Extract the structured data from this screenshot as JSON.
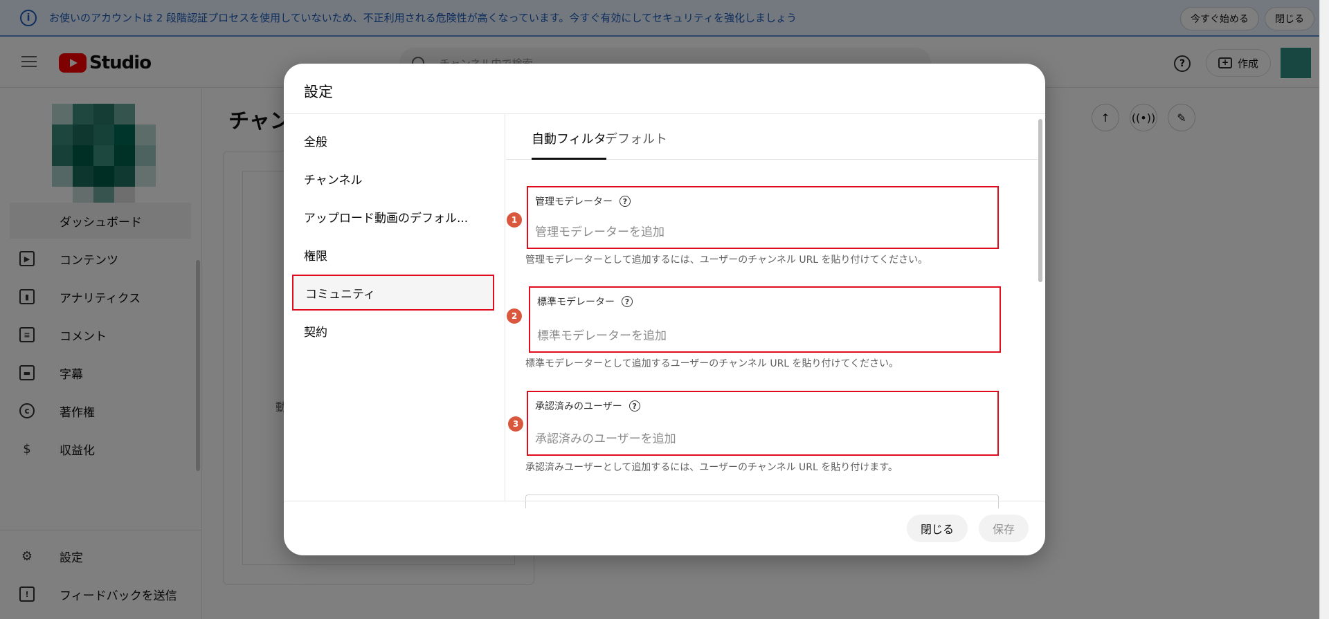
{
  "banner": {
    "message": "お使いのアカウントは 2 段階認証プロセスを使用していないため、不正利用される危険性が高くなっています。今すぐ有効にしてセキュリティを強化しましょう",
    "start_label": "今すぐ始める",
    "close_label": "閉じる"
  },
  "topbar": {
    "logo_text": "Studio",
    "search_placeholder": "チャンネル内で検索",
    "create_label": "作成"
  },
  "sidebar": {
    "items": [
      {
        "label": "ダッシュボード",
        "icon": "dashboard-icon"
      },
      {
        "label": "コンテンツ",
        "icon": "content-icon"
      },
      {
        "label": "アナリティクス",
        "icon": "analytics-icon"
      },
      {
        "label": "コメント",
        "icon": "comment-icon"
      },
      {
        "label": "字幕",
        "icon": "subtitles-icon"
      },
      {
        "label": "著作権",
        "icon": "copyright-icon"
      },
      {
        "label": "収益化",
        "icon": "monetization-icon"
      }
    ],
    "bottom_items": [
      {
        "label": "設定",
        "icon": "gear-icon"
      },
      {
        "label": "フィードバックを送信",
        "icon": "feedback-icon"
      }
    ]
  },
  "main": {
    "title_partial": "チャン",
    "card_partial_char": "動"
  },
  "dialog": {
    "title": "設定",
    "nav": [
      "全般",
      "チャンネル",
      "アップロード動画のデフォル...",
      "権限",
      "コミュニティ",
      "契約"
    ],
    "active_nav_index": 4,
    "tabs": [
      "自動フィルタ",
      "デフォルト"
    ],
    "active_tab_index": 0,
    "fields": [
      {
        "number": "1",
        "label": "管理モデレーター",
        "placeholder": "管理モデレーターを追加",
        "value": "",
        "hint": "管理モデレーターとして追加するには、ユーザーのチャンネル URL を貼り付けてください。"
      },
      {
        "number": "2",
        "label": "標準モデレーター",
        "placeholder": "標準モデレーターを追加",
        "value": "",
        "hint": "標準モデレーターとして追加するユーザーのチャンネル URL を貼り付けてください。"
      },
      {
        "number": "3",
        "label": "承認済みのユーザー",
        "placeholder": "承認済みのユーザーを追加",
        "value": "",
        "hint": "承認済みユーザーとして追加するには、ユーザーのチャンネル URL を貼り付けます。"
      }
    ],
    "close_label": "閉じる",
    "save_label": "保存"
  },
  "colors": {
    "highlight_border": "#e00b1c",
    "step_badge": "#d9573c",
    "banner_text": "#1a5bb8",
    "youtube_red": "#ff0000"
  }
}
